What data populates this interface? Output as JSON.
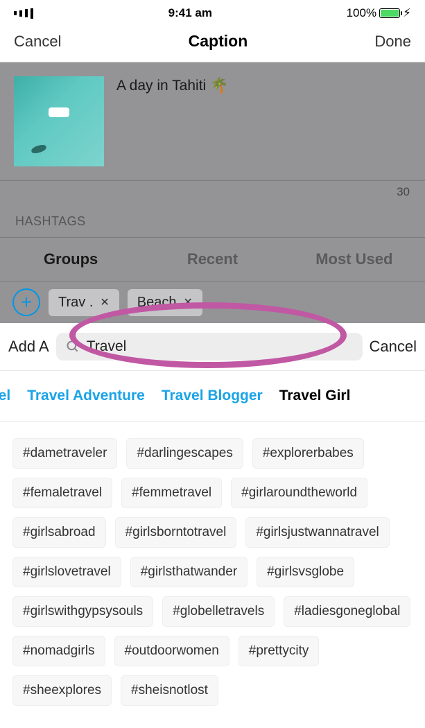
{
  "status": {
    "time": "9:41 am",
    "battery_pct": "100%"
  },
  "nav": {
    "cancel": "Cancel",
    "title": "Caption",
    "done": "Done"
  },
  "caption": {
    "text": "A day in Tahiti 🌴",
    "count": "30"
  },
  "hashtags_label": "HASHTAGS",
  "tabs": {
    "groups": "Groups",
    "recent": "Recent",
    "most_used": "Most Used"
  },
  "pills": [
    {
      "label": "Trav  .",
      "x": "✕"
    },
    {
      "label": "Beach",
      "x": "✕"
    }
  ],
  "search": {
    "left_label": "Add A",
    "query": "Travel",
    "cancel": "Cancel"
  },
  "categories": [
    {
      "label": "vel",
      "selected": false,
      "cut": true
    },
    {
      "label": "Travel Adventure",
      "selected": false
    },
    {
      "label": "Travel Blogger",
      "selected": false
    },
    {
      "label": "Travel Girl",
      "selected": true
    }
  ],
  "hashtags": [
    "#dametraveler",
    "#darlingescapes",
    "#explorerbabes",
    "#femaletravel",
    "#femmetravel",
    "#girlaroundtheworld",
    "#girlsabroad",
    "#girlsborntotravel",
    "#girlsjustwannatravel",
    "#girlslovetravel",
    "#girlsthatwander",
    "#girlsvsglobe",
    "#girlswithgypsysouls",
    "#globelletravels",
    "#ladiesgoneglobal",
    "#nomadgirls",
    "#outdoorwomen",
    "#prettycity",
    "#sheexplores",
    "#sheisnotlost"
  ]
}
